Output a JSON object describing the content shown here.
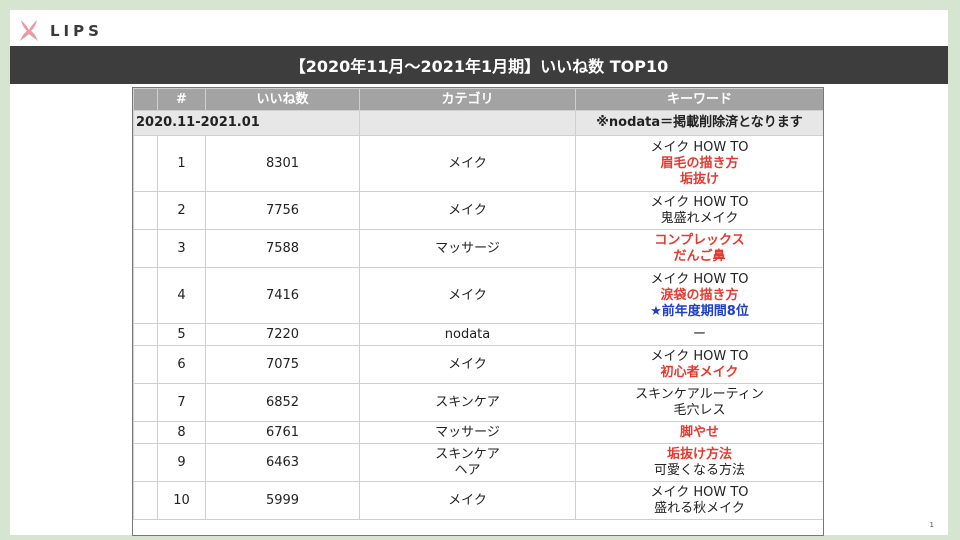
{
  "brand": {
    "logo_text": "LIPS",
    "accent": "#e88a96"
  },
  "title": "【2020年11月～2021年1月期】いいね数 TOP10",
  "table": {
    "headers": [
      "#",
      "いいね数",
      "カテゴリ",
      "キーワード"
    ],
    "section": {
      "range": "2020.11-2021.01",
      "note": "※nodata＝掲載削除済となります"
    },
    "rows": [
      {
        "rank": "1",
        "likes": "8301",
        "category": [
          "メイク"
        ],
        "keywords": [
          {
            "text": "メイク HOW TO",
            "style": "plain"
          },
          {
            "text": "眉毛の描き方",
            "style": "red"
          },
          {
            "text": "垢抜け",
            "style": "red"
          }
        ]
      },
      {
        "rank": "2",
        "likes": "7756",
        "category": [
          "メイク"
        ],
        "keywords": [
          {
            "text": "メイク HOW TO",
            "style": "plain"
          },
          {
            "text": "鬼盛れメイク",
            "style": "plain"
          }
        ]
      },
      {
        "rank": "3",
        "likes": "7588",
        "category": [
          "マッサージ"
        ],
        "keywords": [
          {
            "text": "コンプレックス",
            "style": "red"
          },
          {
            "text": "だんご鼻",
            "style": "red"
          }
        ]
      },
      {
        "rank": "4",
        "likes": "7416",
        "category": [
          "メイク"
        ],
        "keywords": [
          {
            "text": "メイク HOW TO",
            "style": "plain"
          },
          {
            "text": "涙袋の描き方",
            "style": "red"
          },
          {
            "text": "★前年度期間8位",
            "style": "blue"
          }
        ]
      },
      {
        "rank": "5",
        "likes": "7220",
        "category": [
          "nodata"
        ],
        "keywords": [
          {
            "text": "ー",
            "style": "plain"
          }
        ]
      },
      {
        "rank": "6",
        "likes": "7075",
        "category": [
          "メイク"
        ],
        "keywords": [
          {
            "text": "メイク HOW TO",
            "style": "plain"
          },
          {
            "text": "初心者メイク",
            "style": "red"
          }
        ]
      },
      {
        "rank": "7",
        "likes": "6852",
        "category": [
          "スキンケア"
        ],
        "keywords": [
          {
            "text": "スキンケアルーティン",
            "style": "plain"
          },
          {
            "text": "毛穴レス",
            "style": "plain"
          }
        ]
      },
      {
        "rank": "8",
        "likes": "6761",
        "category": [
          "マッサージ"
        ],
        "keywords": [
          {
            "text": "脚やせ",
            "style": "red"
          }
        ]
      },
      {
        "rank": "9",
        "likes": "6463",
        "category": [
          "スキンケア",
          "ヘア"
        ],
        "keywords": [
          {
            "text": "垢抜け方法",
            "style": "red"
          },
          {
            "text": "可愛くなる方法",
            "style": "plain"
          }
        ]
      },
      {
        "rank": "10",
        "likes": "5999",
        "category": [
          "メイク"
        ],
        "keywords": [
          {
            "text": "メイク HOW TO",
            "style": "plain"
          },
          {
            "text": "盛れる秋メイク",
            "style": "plain"
          }
        ]
      }
    ]
  },
  "page_number": "1",
  "colors": {
    "title_bar": "#3d3d3d",
    "header": "#a3a3a3",
    "red": "#e53a2f",
    "blue": "#1f3fc4",
    "background": "#d6e5cf"
  }
}
